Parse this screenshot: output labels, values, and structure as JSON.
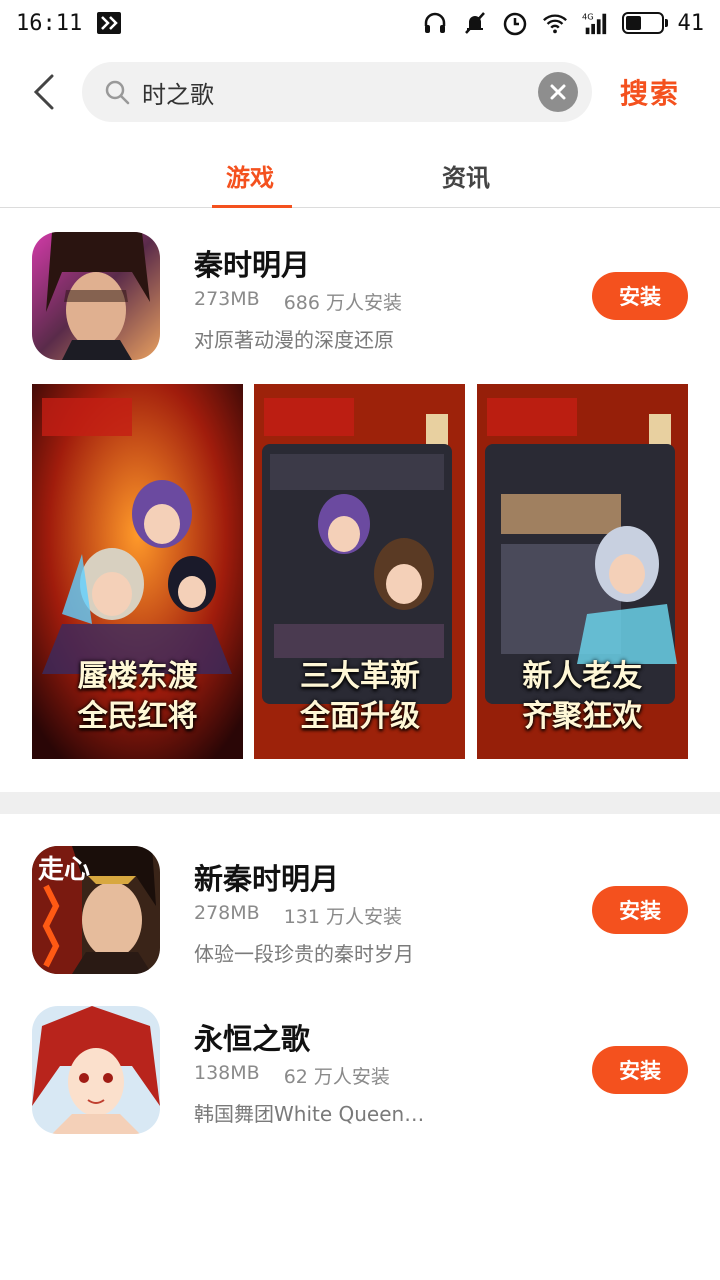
{
  "status_bar": {
    "time": "16:11",
    "battery_level": "41"
  },
  "search": {
    "query": "时之歌",
    "button_label": "搜索"
  },
  "tabs": [
    {
      "label": "游戏",
      "active": true
    },
    {
      "label": "资讯",
      "active": false
    }
  ],
  "apps": [
    {
      "name": "秦时明月",
      "size": "273MB",
      "installs": "686 万人安装",
      "description": "对原著动漫的深度还原",
      "install_label": "安装",
      "icon": "qin-warrior-portrait",
      "screenshots": [
        {
          "caption_line1": "蜃楼东渡",
          "caption_line2": "全民红将"
        },
        {
          "caption_line1": "三大革新",
          "caption_line2": "全面升级"
        },
        {
          "caption_line1": "新人老友",
          "caption_line2": "齐聚狂欢"
        }
      ]
    },
    {
      "name": "新秦时明月",
      "size": "278MB",
      "installs": "131 万人安装",
      "description": "体验一段珍贵的秦时岁月",
      "install_label": "安装",
      "icon": "new-qin-warrior-portrait",
      "icon_badge": "走心"
    },
    {
      "name": "永恒之歌",
      "size": "138MB",
      "installs": "62 万人安装",
      "description": "韩国舞团White Queen…",
      "install_label": "安装",
      "icon": "red-hair-girl-portrait"
    }
  ],
  "colors": {
    "accent": "#f4511e",
    "search_bg": "#f1f1f1",
    "divider": "#efefef"
  }
}
